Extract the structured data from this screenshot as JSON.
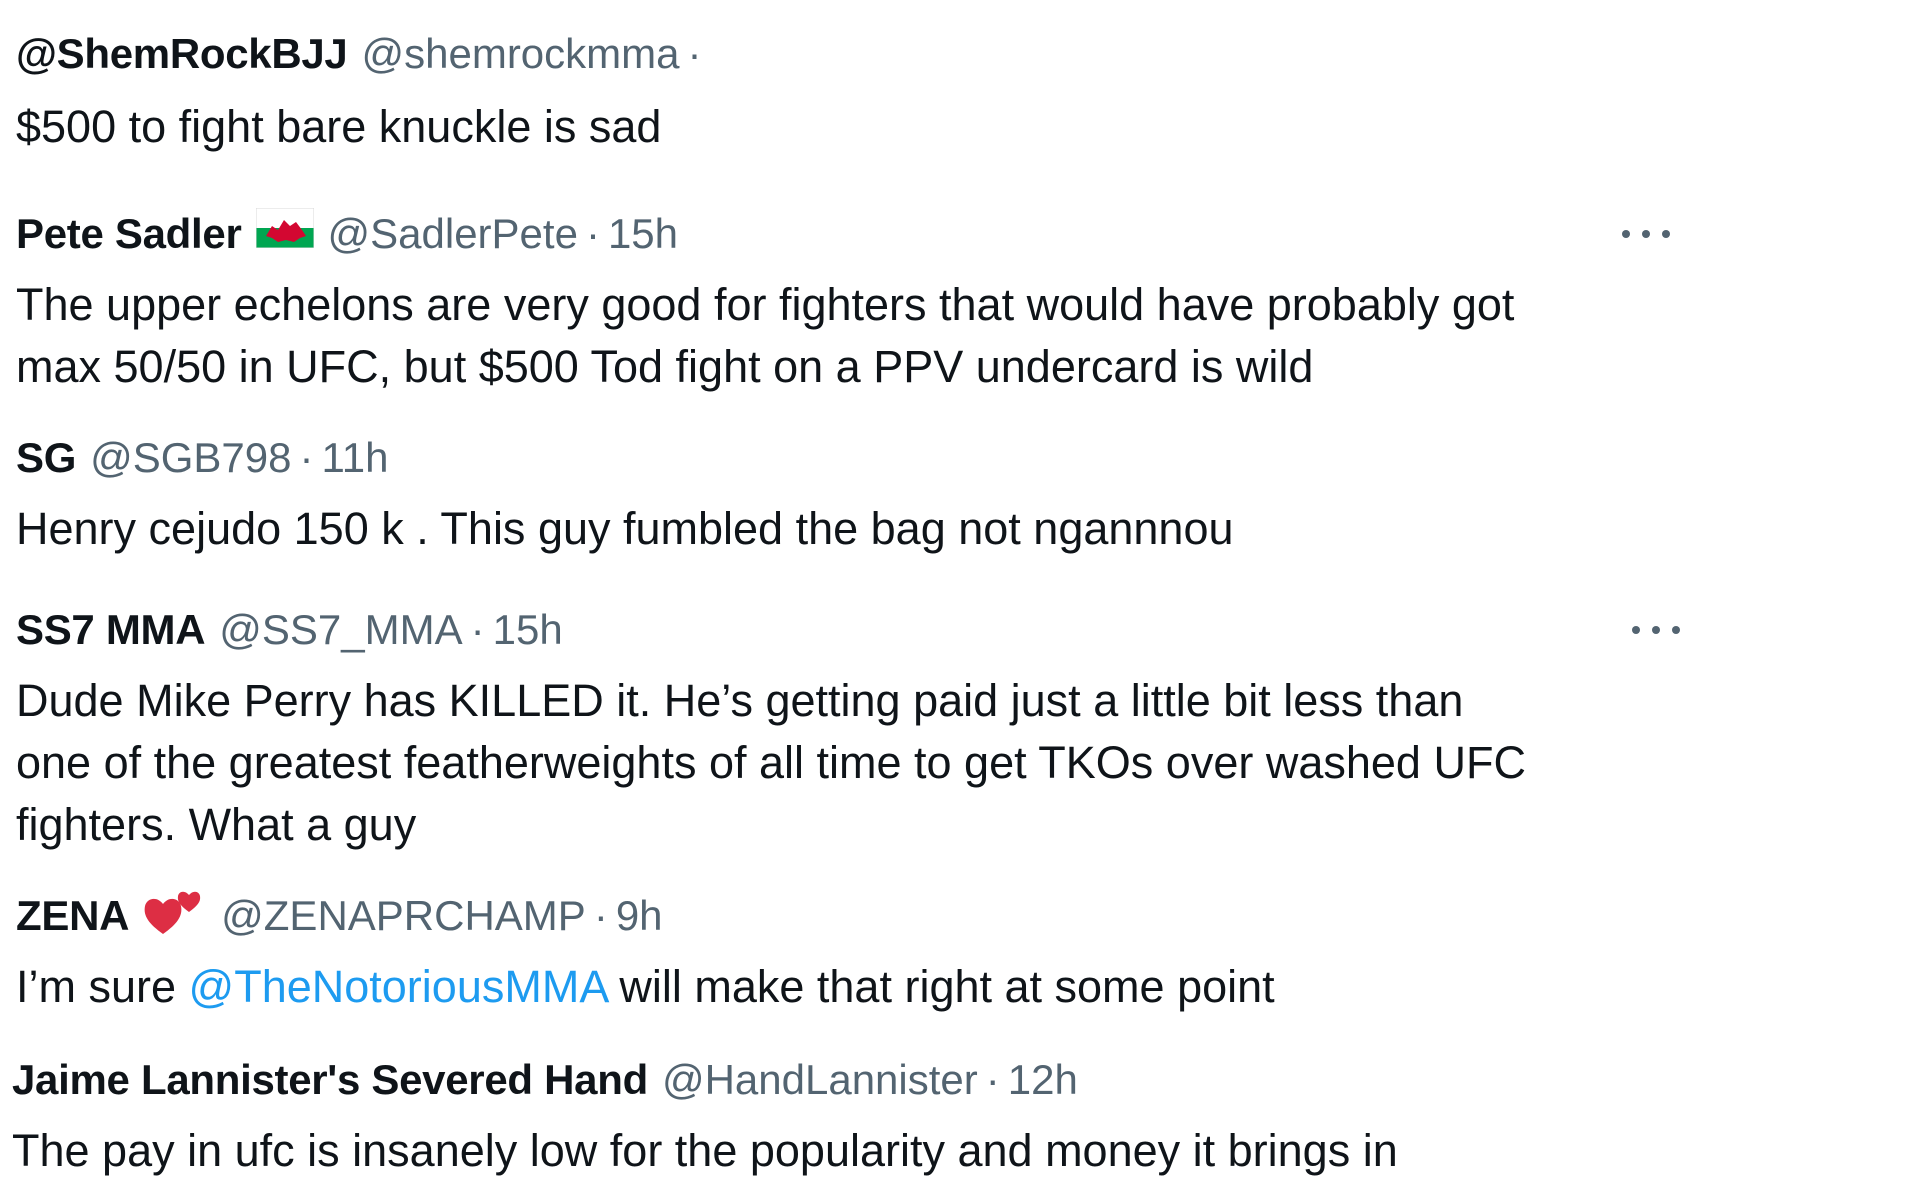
{
  "replies": [
    {
      "name": "@ShemRockBJJ",
      "handle": "@shemrockmma",
      "sep": "·",
      "time": "",
      "emoji": "",
      "text": "$500 to fight bare knuckle is sad",
      "has_more": false
    },
    {
      "name": "Pete Sadler",
      "handle": "@SadlerPete",
      "sep": "·",
      "time": "15h",
      "emoji": "wales-flag",
      "text": "The upper echelons are very good for fighters that would have probably got\nmax 50/50 in UFC, but $500 Tod fight on a PPV undercard is wild",
      "has_more": true
    },
    {
      "name": "SG",
      "handle": "@SGB798",
      "sep": "·",
      "time": "11h",
      "emoji": "",
      "text": "Henry cejudo 150 k . This guy fumbled the bag not ngannnou",
      "has_more": false
    },
    {
      "name": "SS7 MMA",
      "handle": "@SS7_MMA",
      "sep": "·",
      "time": "15h",
      "emoji": "",
      "text": "Dude Mike Perry has KILLED it. He’s getting paid just a little bit less than\none of the greatest featherweights of all time to get TKOs over washed UFC\nfighters. What a guy",
      "has_more": true
    },
    {
      "name": "ZENA",
      "handle": "@ZENAPRCHAMP",
      "sep": "·",
      "time": "9h",
      "emoji": "two-hearts",
      "text_before": "I’m sure ",
      "mention": "@TheNotoriousMMA",
      "text_after": " will make that right at some point",
      "has_more": false
    },
    {
      "name": "Jaime Lannister's Severed Hand",
      "handle": "@HandLannister",
      "sep": "·",
      "time": "12h",
      "emoji": "",
      "text": "The pay in ufc is insanely low for the popularity and money it brings in",
      "has_more": false
    }
  ],
  "colors": {
    "text": "#0f1419",
    "secondary": "#536471",
    "link": "#1d9bf0"
  }
}
